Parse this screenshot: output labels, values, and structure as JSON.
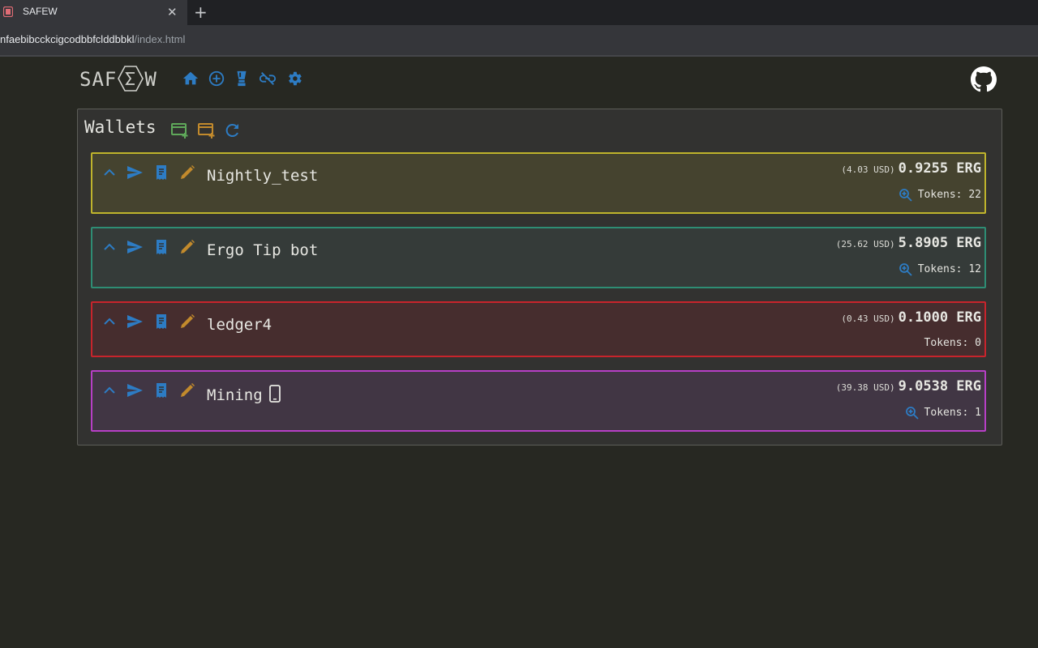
{
  "browser": {
    "tab_title": "SAFEW",
    "close_glyph": "✕",
    "new_tab_glyph": "+",
    "url_host": "nfaebibcckcigcodbbfclddbbkl",
    "url_path": "/index.html"
  },
  "app": {
    "brand_left": "SAF",
    "brand_right": "W",
    "nav_icons": [
      "home-icon",
      "add-circle-icon",
      "blender-icon",
      "link-off-icon",
      "gear-icon"
    ],
    "github_icon": "github-icon"
  },
  "wallets_panel": {
    "title": "Wallets",
    "tool_icons": [
      "add-wallet-icon",
      "add-ledger-wallet-icon",
      "refresh-icon"
    ]
  },
  "wallets": [
    {
      "name": "Nightly_test",
      "usd": "(4.03 USD)",
      "erg": "0.9255 ERG",
      "tokens": "Tokens: 22",
      "show_zoom": true,
      "mobile_icon": false,
      "border": "#bfb42c",
      "bg": "#45432f"
    },
    {
      "name": "Ergo Tip bot",
      "usd": "(25.62 USD)",
      "erg": "5.8905 ERG",
      "tokens": "Tokens: 12",
      "show_zoom": true,
      "mobile_icon": false,
      "border": "#2e8d74",
      "bg": "#353b39"
    },
    {
      "name": "ledger4",
      "usd": "(0.43 USD)",
      "erg": "0.1000 ERG",
      "tokens": "Tokens: 0",
      "show_zoom": false,
      "mobile_icon": false,
      "border": "#c8242c",
      "bg": "#462d2e"
    },
    {
      "name": "Mining",
      "usd": "(39.38 USD)",
      "erg": "9.0538 ERG",
      "tokens": "Tokens: 1",
      "show_zoom": true,
      "mobile_icon": true,
      "border": "#b73fc6",
      "bg": "#413644"
    }
  ],
  "colors": {
    "accent_blue": "#2d7cc4",
    "edit_orange": "#c28a2c",
    "add_green": "#5fa85a"
  }
}
